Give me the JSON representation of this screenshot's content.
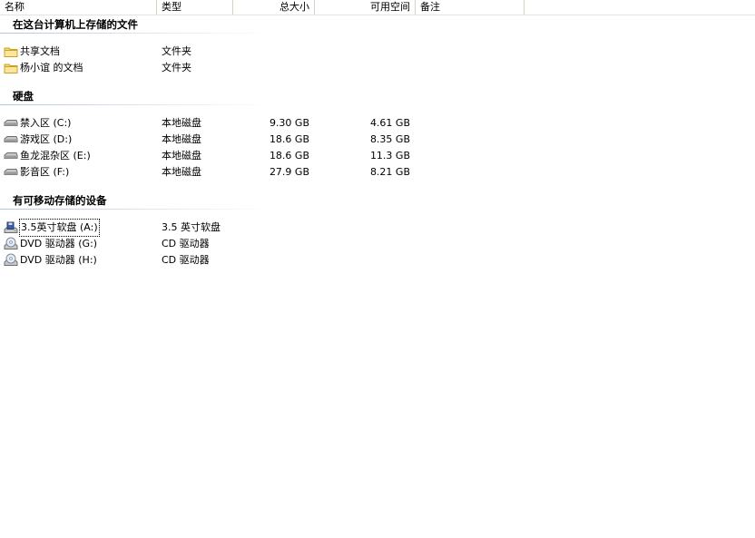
{
  "columns": {
    "name": "名称",
    "type": "类型",
    "total_size": "总大小",
    "free_space": "可用空间",
    "comments": "备注"
  },
  "groups": [
    {
      "title": "在这台计算机上存储的文件",
      "items": [
        {
          "icon": "folder-icon",
          "name": "共享文档",
          "type": "文件夹",
          "size": "",
          "free": ""
        },
        {
          "icon": "folder-icon",
          "name": "杨小谊 的文档",
          "type": "文件夹",
          "size": "",
          "free": ""
        }
      ]
    },
    {
      "title": "硬盘",
      "items": [
        {
          "icon": "hard-drive-icon",
          "name": "禁入区 (C:)",
          "type": "本地磁盘",
          "size": "9.30 GB",
          "free": "4.61 GB"
        },
        {
          "icon": "hard-drive-icon",
          "name": "游戏区 (D:)",
          "type": "本地磁盘",
          "size": "18.6 GB",
          "free": "8.35 GB"
        },
        {
          "icon": "hard-drive-icon",
          "name": "鱼龙混杂区 (E:)",
          "type": "本地磁盘",
          "size": "18.6 GB",
          "free": "11.3 GB"
        },
        {
          "icon": "hard-drive-icon",
          "name": "影音区 (F:)",
          "type": "本地磁盘",
          "size": "27.9 GB",
          "free": "8.21 GB"
        }
      ]
    },
    {
      "title": "有可移动存储的设备",
      "items": [
        {
          "icon": "floppy-drive-icon",
          "name": "3.5英寸软盘 (A:)",
          "type": "3.5 英寸软盘",
          "size": "",
          "free": ""
        },
        {
          "icon": "dvd-drive-icon",
          "name": "DVD 驱动器 (G:)",
          "type": "CD 驱动器",
          "size": "",
          "free": ""
        },
        {
          "icon": "dvd-drive-icon",
          "name": "DVD 驱动器 (H:)",
          "type": "CD 驱动器",
          "size": "",
          "free": ""
        }
      ]
    }
  ]
}
